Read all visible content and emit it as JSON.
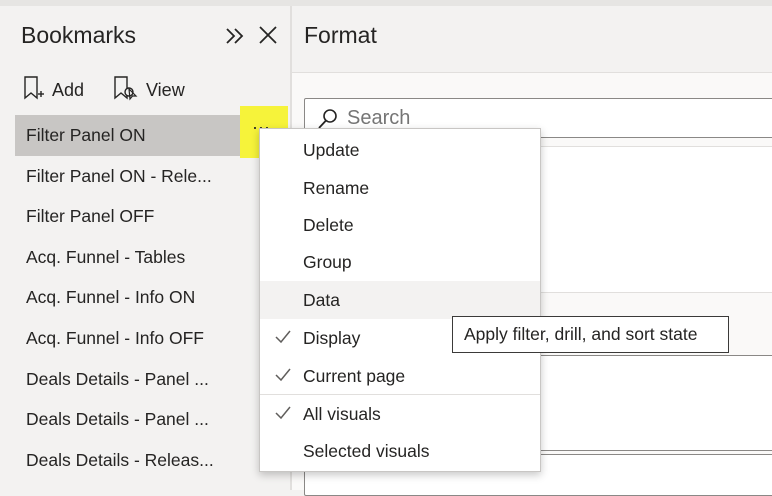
{
  "bookmarks_pane": {
    "title": "Bookmarks",
    "expand_icon": "double-chevron-right-icon",
    "close_icon": "close-icon",
    "toolbar": {
      "add_label": "Add",
      "add_icon": "bookmark-add-icon",
      "view_label": "View",
      "view_icon": "bookmark-view-icon"
    },
    "items": [
      {
        "label": "Filter Panel ON",
        "selected": true
      },
      {
        "label": "Filter Panel ON - Rele..."
      },
      {
        "label": "Filter Panel OFF"
      },
      {
        "label": "Acq. Funnel - Tables"
      },
      {
        "label": "Acq. Funnel - Info ON"
      },
      {
        "label": "Acq. Funnel - Info OFF"
      },
      {
        "label": "Deals Details - Panel ..."
      },
      {
        "label": "Deals Details - Panel ..."
      },
      {
        "label": "Deals Details - Releas..."
      }
    ],
    "more_options_icon": "more-options-icon",
    "highlight_color": "#f6f33a"
  },
  "format_pane": {
    "title": "Format",
    "search": {
      "placeholder": "Search",
      "icon": "search-icon"
    }
  },
  "context_menu": {
    "items": [
      {
        "label": "Update",
        "checked": false
      },
      {
        "label": "Rename",
        "checked": false
      },
      {
        "label": "Delete",
        "checked": false
      },
      {
        "label": "Group",
        "checked": false
      },
      {
        "label": "Data",
        "checked": false,
        "hovered": true
      },
      {
        "label": "Display",
        "checked": true
      },
      {
        "label": "Current page",
        "checked": true
      },
      {
        "label": "All visuals",
        "checked": true
      },
      {
        "label": "Selected visuals",
        "checked": false
      }
    ]
  },
  "tooltip": {
    "text": "Apply filter, drill, and sort state"
  }
}
